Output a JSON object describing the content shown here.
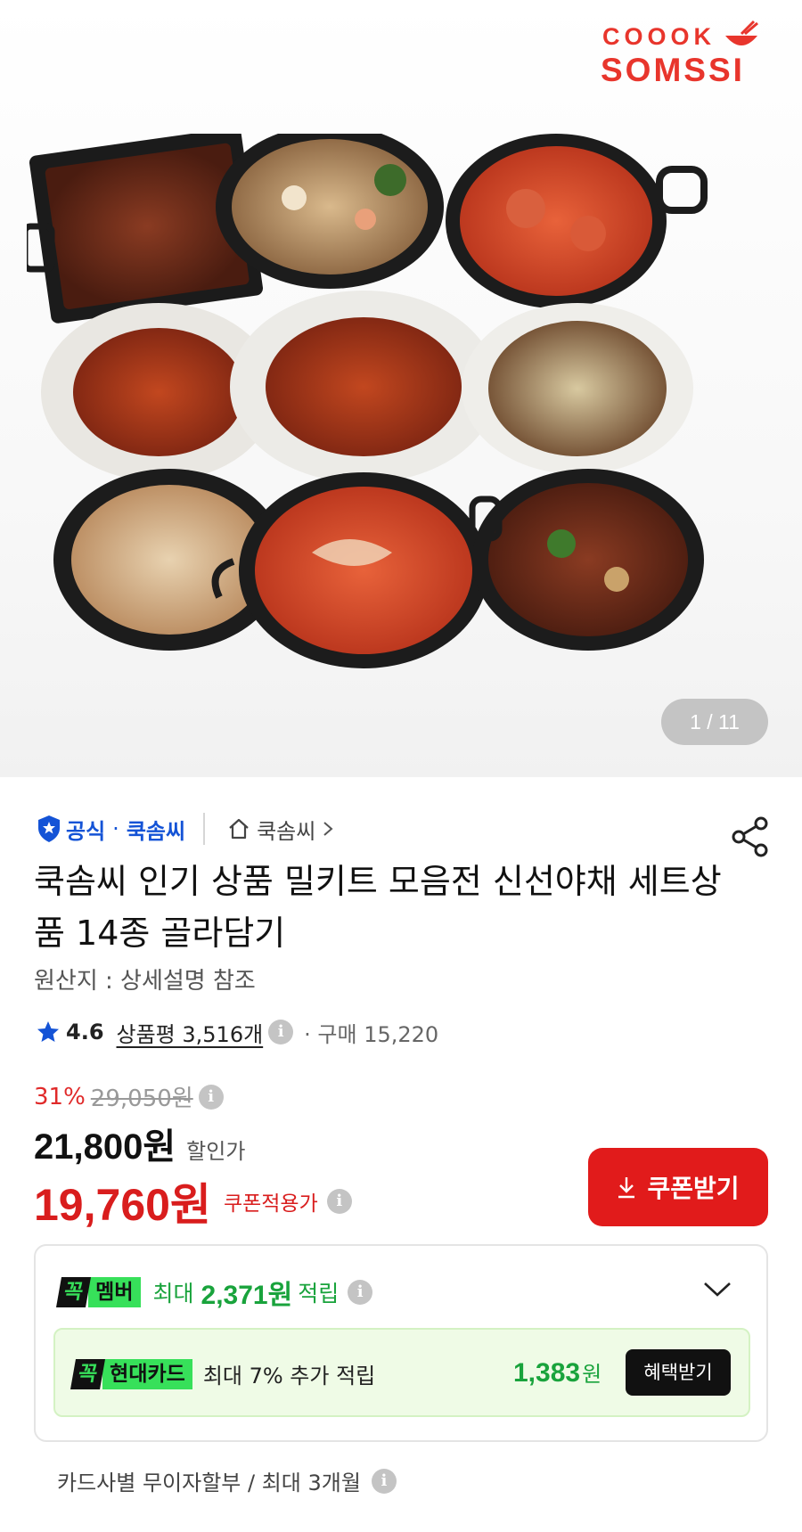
{
  "logo": {
    "line1": "COOOK",
    "line2": "SOMSSI",
    "color": "#e8352c"
  },
  "gallery": {
    "pager": "1 / 11"
  },
  "seller": {
    "official_label": "공식",
    "separator": "·",
    "brand": "쿡솜씨",
    "store_link": "쿡솜씨"
  },
  "product": {
    "title": "쿡솜씨 인기 상품 밀키트 모음전 신선야채 세트상품 14종 골라담기",
    "origin": "원산지 : 상세설명 참조",
    "rating": "4.6",
    "reviews": "상품평 3,516개",
    "purchases": "· 구매 15,220"
  },
  "price": {
    "discount_rate": "31%",
    "original": "29,050원",
    "sale": "21,800원",
    "sale_label": "할인가",
    "coupon": "19,760원",
    "coupon_label": "쿠폰적용가",
    "coupon_button": "쿠폰받기"
  },
  "benefit": {
    "member_tag_k": "꼭",
    "member_tag_text": "멤버",
    "max_label": "최대",
    "max_amount": "2,371원",
    "save_label": "적립",
    "card_tag_k": "꼭",
    "card_tag_text": "현대카드",
    "card_text": "최대 7% 추가 적립",
    "card_amount": "1,383",
    "card_won": "원",
    "card_button": "혜택받기"
  },
  "installment": {
    "text": "카드사별 무이자할부 / 최대 3개월"
  },
  "colors": {
    "accent_red": "#e11b1b",
    "brand_blue": "#1453d6",
    "green": "#19a33c",
    "green_tag": "#37e05a"
  }
}
